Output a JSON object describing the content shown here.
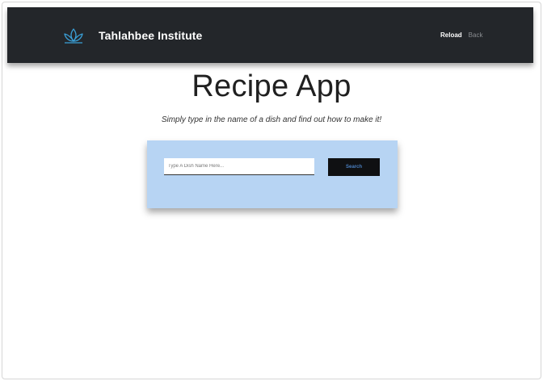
{
  "navbar": {
    "brand_icon": "lotus-icon",
    "brand_name": "Tahlahbee Institute",
    "links": {
      "reload": "Reload",
      "back": "Back"
    }
  },
  "main": {
    "title": "Recipe App",
    "subtitle": "Simply type in the name of a dish and find out how to make it!"
  },
  "search": {
    "placeholder": "Type A Dish Name Here...",
    "value": "",
    "button_label": "Search"
  },
  "colors": {
    "navbar_bg": "#23262a",
    "card_bg": "#b7d4f3",
    "button_bg": "#0f1012",
    "button_text": "#4a7fc0",
    "brand_icon": "#3aa0d8"
  }
}
